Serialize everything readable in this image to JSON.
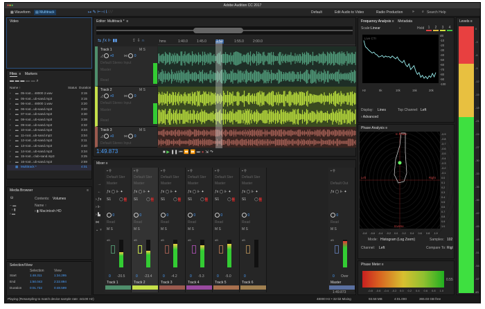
{
  "window": {
    "title": "Adobe Audition CC 2017"
  },
  "toolbar": {
    "waveform": "Waveform",
    "multitrack": "Multitrack",
    "workspaces": [
      "Default",
      "Edit Audio to Video",
      "Radio Production"
    ],
    "more": "»",
    "search_placeholder": "Search Help"
  },
  "video_panel": {
    "title": "Video"
  },
  "files_panel": {
    "tabs": [
      "Files",
      "Markers"
    ],
    "columns": [
      "Name ↑",
      "Status",
      "Duration"
    ],
    "files": [
      {
        "name": "05-root... 48000 2.wav",
        "duration": "3:15"
      },
      {
        "name": "05-root...ub-sand.mp3",
        "duration": "3:15"
      },
      {
        "name": "06-root... 48000 1.wav",
        "duration": "3:20"
      },
      {
        "name": "06-root...ub-sand.mp3",
        "duration": "3:20"
      },
      {
        "name": "07-root...ub-sand.mp3",
        "duration": "3:30"
      },
      {
        "name": "08-root...ub-sand.mp3",
        "duration": "3:38"
      },
      {
        "name": "09-root...ub-sand.mp3",
        "duration": "3:32"
      },
      {
        "name": "10-root...ub-sand.mp3",
        "duration": "3:24"
      },
      {
        "name": "11-root...ub-sand.mp3",
        "duration": "3:04"
      },
      {
        "name": "12-root...ub-sand.mp3",
        "duration": "3:11"
      },
      {
        "name": "13-root...ub-sand.mp3",
        "duration": "3:40"
      },
      {
        "name": "14-root...ub-sand.mp3",
        "duration": "3:34"
      },
      {
        "name": "15-root...club-sand.mp3",
        "duration": "3:25"
      },
      {
        "name": "16-root...ub-sand.mp3",
        "duration": "2:59"
      }
    ],
    "session": {
      "name": "Multitrack *",
      "duration": "4:01"
    }
  },
  "media_browser": {
    "title": "Media Browser",
    "contents_label": "Contents:",
    "contents_value": "Volumes",
    "name_col": "Name ↑",
    "volume": "Macintosh HD"
  },
  "selection_view": {
    "title": "Selection/View",
    "col_selection": "Selection",
    "col_view": "View",
    "rows": [
      {
        "label": "Start",
        "selection": "1:48.311",
        "view": "1:34.295"
      },
      {
        "label": "End",
        "selection": "1:50.043",
        "view": "2:22.894"
      },
      {
        "label": "Duration",
        "selection": "0:01.732",
        "view": "0:48.599"
      }
    ]
  },
  "editor": {
    "title": "Editor: Multitrack *",
    "ruler": [
      "hms",
      "1:40.0",
      "1:45.0",
      "1:50",
      "1:55.0",
      "2:00.0"
    ],
    "current_time": "1:49.873",
    "tracks": [
      {
        "name": "Track 1",
        "volume": "+0",
        "pan": "0",
        "input": "Default Stereo Input",
        "output": "Master",
        "mode": "Read",
        "color": "#4f8f6c",
        "wave": "#4f9a7a"
      },
      {
        "name": "Track 2",
        "volume": "+0",
        "pan": "0",
        "input": "Default Stereo Input",
        "output": "Master",
        "mode": "Read",
        "color": "#c5e04a",
        "wave": "#b8dc3c"
      },
      {
        "name": "Track 3",
        "volume": "+0",
        "pan": "0",
        "input": "Default Stereo Input",
        "output": "Master",
        "mode": "Read",
        "color": "#9a5a4e",
        "wave": "#9a5a50"
      }
    ]
  },
  "mixer": {
    "title": "Mixer",
    "input": "Default Ster",
    "output": "Master",
    "mode": "Read",
    "send": "S1",
    "pan": "0",
    "strips": [
      {
        "name": "Track 1",
        "pan": "0",
        "level": "-20.5",
        "fill": 0.55,
        "color": "#4f8f6c"
      },
      {
        "name": "Track 2",
        "pan": "0",
        "level": "-23.4",
        "fill": 0.6,
        "color": "#c5e04a"
      },
      {
        "name": "Track 3",
        "pan": "0",
        "level": "-4.2",
        "fill": 0.85,
        "color": "#9a5a4e"
      },
      {
        "name": "Track 4",
        "pan": "0",
        "level": "-5.3",
        "fill": 0.8,
        "color": "#9a4aa0"
      },
      {
        "name": "Track 5",
        "pan": "0",
        "level": "-5.0",
        "fill": 0.85,
        "color": "#a8704e"
      },
      {
        "name": "Track 6",
        "pan": "0",
        "level": "",
        "fill": 0,
        "color": "#a08050"
      }
    ],
    "master": {
      "name": "Master",
      "output": "Default Out",
      "pan": "0",
      "level": "Over",
      "fill": 0.95,
      "color": "#5a70a0",
      "time": "1:49.873"
    }
  },
  "frequency_analysis": {
    "tabs": [
      "Frequency Analysis",
      "Metadata"
    ],
    "scale_label": "Scale:",
    "scale": "Linear",
    "hold_label": "Hold",
    "holds": [
      "1",
      "2",
      "3",
      "4"
    ],
    "hold_colors": [
      "#e04040",
      "#e0c040",
      "#d0e040",
      "#40c040"
    ],
    "channel_tag": "Live CTI",
    "x_ticks": [
      "Hz",
      "5k",
      "10k",
      "15k",
      "20k"
    ],
    "y_ticks": [
      "dB",
      "-10",
      "-20",
      "-30",
      "-40",
      "-50",
      "-60",
      "-70",
      "-80",
      "-90",
      "-100"
    ],
    "display_label": "Display:",
    "display": "Lines",
    "top_channel_label": "Top Channel:",
    "top_channel": "Left",
    "advanced": "Advanced",
    "spectrum_db": [
      -12,
      -25,
      -28,
      -32,
      -35,
      -38,
      -36,
      -40,
      -42,
      -46,
      -45,
      -43,
      -47,
      -44,
      -46,
      -45,
      -48,
      -44,
      -47,
      -50,
      -46,
      -52,
      -55,
      -58,
      -53,
      -62,
      -66,
      -60,
      -72,
      -68,
      -64,
      -75,
      -82,
      -78,
      -88,
      -84,
      -90,
      -86,
      -91,
      -85,
      -88,
      -80,
      -87,
      -78
    ]
  },
  "phase_analysis": {
    "title": "Phase Analysis",
    "labels": {
      "top": "In Phase",
      "left": "Left",
      "right": "Right",
      "bottom": "Inverse"
    },
    "x_ticks": [
      "-0.8",
      "-0.6",
      "-0.4",
      "-0.2",
      "0.0",
      "0.2",
      "0.4",
      "0.6",
      "0.8",
      "1.0"
    ],
    "y_ticks": [
      "-0.9",
      "-0.8",
      "-0.7",
      "-0.6",
      "-0.5",
      "-0.4",
      "-0.3",
      "-0.2",
      "-0.1",
      "0.0",
      "0.1",
      "0.2",
      "0.3",
      "0.4",
      "0.5",
      "0.6",
      "0.7",
      "0.8",
      "0.9",
      "1.0"
    ],
    "mode_label": "Mode:",
    "mode": "Histogram (Log Zoom)",
    "samples_label": "Samples:",
    "samples": "102",
    "channel_label": "Channel:",
    "channel": "Left",
    "compare_label": "Compare To:",
    "compare": "Rigl"
  },
  "phase_meter": {
    "title": "Phase Meter",
    "value": "0.55",
    "ticks": [
      "-0.8",
      "-0.6",
      "-0.4",
      "-0.2",
      "0.0",
      "0.2",
      "0.4",
      "0.6",
      "0.8",
      "1.0"
    ]
  },
  "levels": {
    "title": "Levels",
    "ticks": [
      "0",
      "-3",
      "-6",
      "-9",
      "-12",
      "-15",
      "-18",
      "-21",
      "-24",
      "-27",
      "-30",
      "-33",
      "-36",
      "-39",
      "-42",
      "-45",
      "-48",
      "-51",
      "-54",
      "-57",
      "dB"
    ]
  },
  "status": {
    "left": "Playing (Resampling to match device sample rate: 44100 Hz)",
    "format": "48000 Hz • 32-bit Mixing",
    "size": "93.58 MB",
    "duration": "4:01.000",
    "free": "365.03 GB free"
  }
}
